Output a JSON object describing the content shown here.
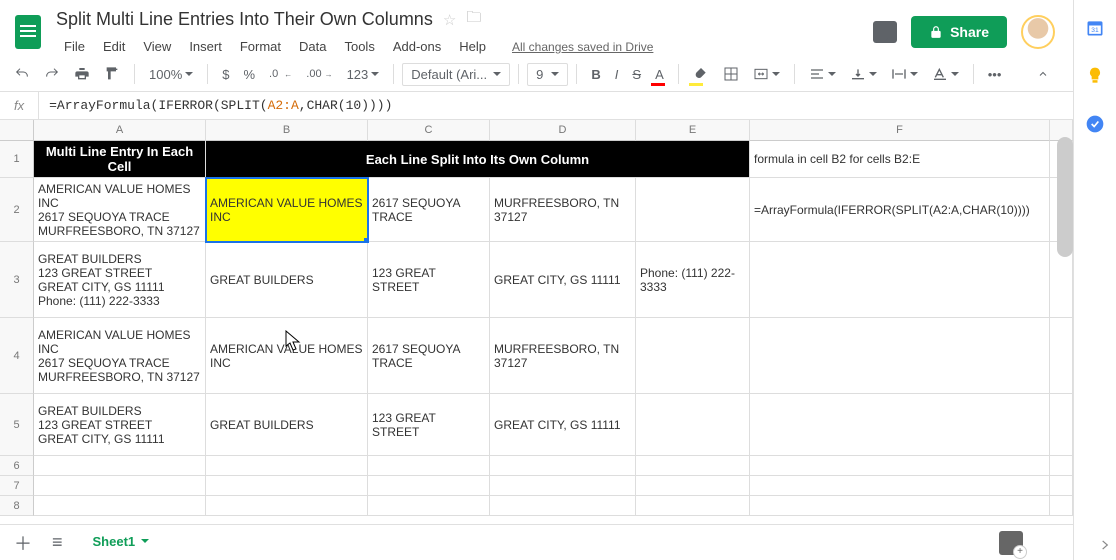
{
  "doc_title": "Split Multi Line Entries Into Their Own Columns",
  "menus": {
    "file": "File",
    "edit": "Edit",
    "view": "View",
    "insert": "Insert",
    "format": "Format",
    "data": "Data",
    "tools": "Tools",
    "addons": "Add-ons",
    "help": "Help"
  },
  "saved_text": "All changes saved in Drive",
  "share_label": "Share",
  "toolbar": {
    "zoom": "100%",
    "currency": "$",
    "percent": "%",
    "dec_dec": ".0",
    "inc_dec": ".00",
    "more_fmt": "123",
    "font": "Default (Ari...",
    "size": "9",
    "bold": "B",
    "italic": "I",
    "strike": "S",
    "text_color": "A"
  },
  "fx_label": "fx",
  "formula_prefix": "=ArrayFormula(IFERROR(SPLIT(",
  "formula_ref": "A2:A",
  "formula_suffix": ",CHAR(10))))",
  "columns": {
    "A": "A",
    "B": "B",
    "C": "C",
    "D": "D",
    "E": "E",
    "F": "F"
  },
  "rows": {
    "r1": "1",
    "r2": "2",
    "r3": "3",
    "r4": "4",
    "r5": "5",
    "r6": "6",
    "r7": "7",
    "r8": "8"
  },
  "header_row": {
    "a": "Multi Line Entry In Each Cell",
    "bcde": "Each Line Split Into Its Own Column",
    "f": "formula in cell B2 for cells B2:E"
  },
  "data": {
    "r2": {
      "a": "AMERICAN VALUE HOMES INC\n2617 SEQUOYA TRACE\nMURFREESBORO, TN 37127",
      "b": "AMERICAN VALUE HOMES INC",
      "c": "2617 SEQUOYA TRACE",
      "d": "MURFREESBORO, TN 37127",
      "e": "",
      "f": "=ArrayFormula(IFERROR(SPLIT(A2:A,CHAR(10))))"
    },
    "r3": {
      "a": "GREAT BUILDERS\n123 GREAT STREET\nGREAT CITY, GS 11111\nPhone: (111) 222-3333",
      "b": "GREAT BUILDERS",
      "c": "123 GREAT STREET",
      "d": "GREAT CITY, GS 11111",
      "e": "Phone: (111) 222-3333",
      "f": ""
    },
    "r4": {
      "a": "AMERICAN VALUE HOMES INC\n2617 SEQUOYA TRACE\nMURFREESBORO, TN 37127",
      "b": "AMERICAN VALUE HOMES INC",
      "c": "2617 SEQUOYA TRACE",
      "d": "MURFREESBORO, TN 37127",
      "e": "",
      "f": ""
    },
    "r5": {
      "a": "GREAT BUILDERS\n123 GREAT STREET\nGREAT CITY, GS 11111",
      "b": "GREAT BUILDERS",
      "c": "123 GREAT STREET",
      "d": "GREAT CITY, GS 11111",
      "e": "",
      "f": ""
    },
    "r6": {
      "a": "",
      "b": "",
      "c": "",
      "d": "",
      "e": "",
      "f": ""
    },
    "r7": {
      "a": "",
      "b": "",
      "c": "",
      "d": "",
      "e": "",
      "f": ""
    },
    "r8": {
      "a": "",
      "b": "",
      "c": "",
      "d": "",
      "e": "",
      "f": ""
    }
  },
  "sheet_tab": "Sheet1"
}
